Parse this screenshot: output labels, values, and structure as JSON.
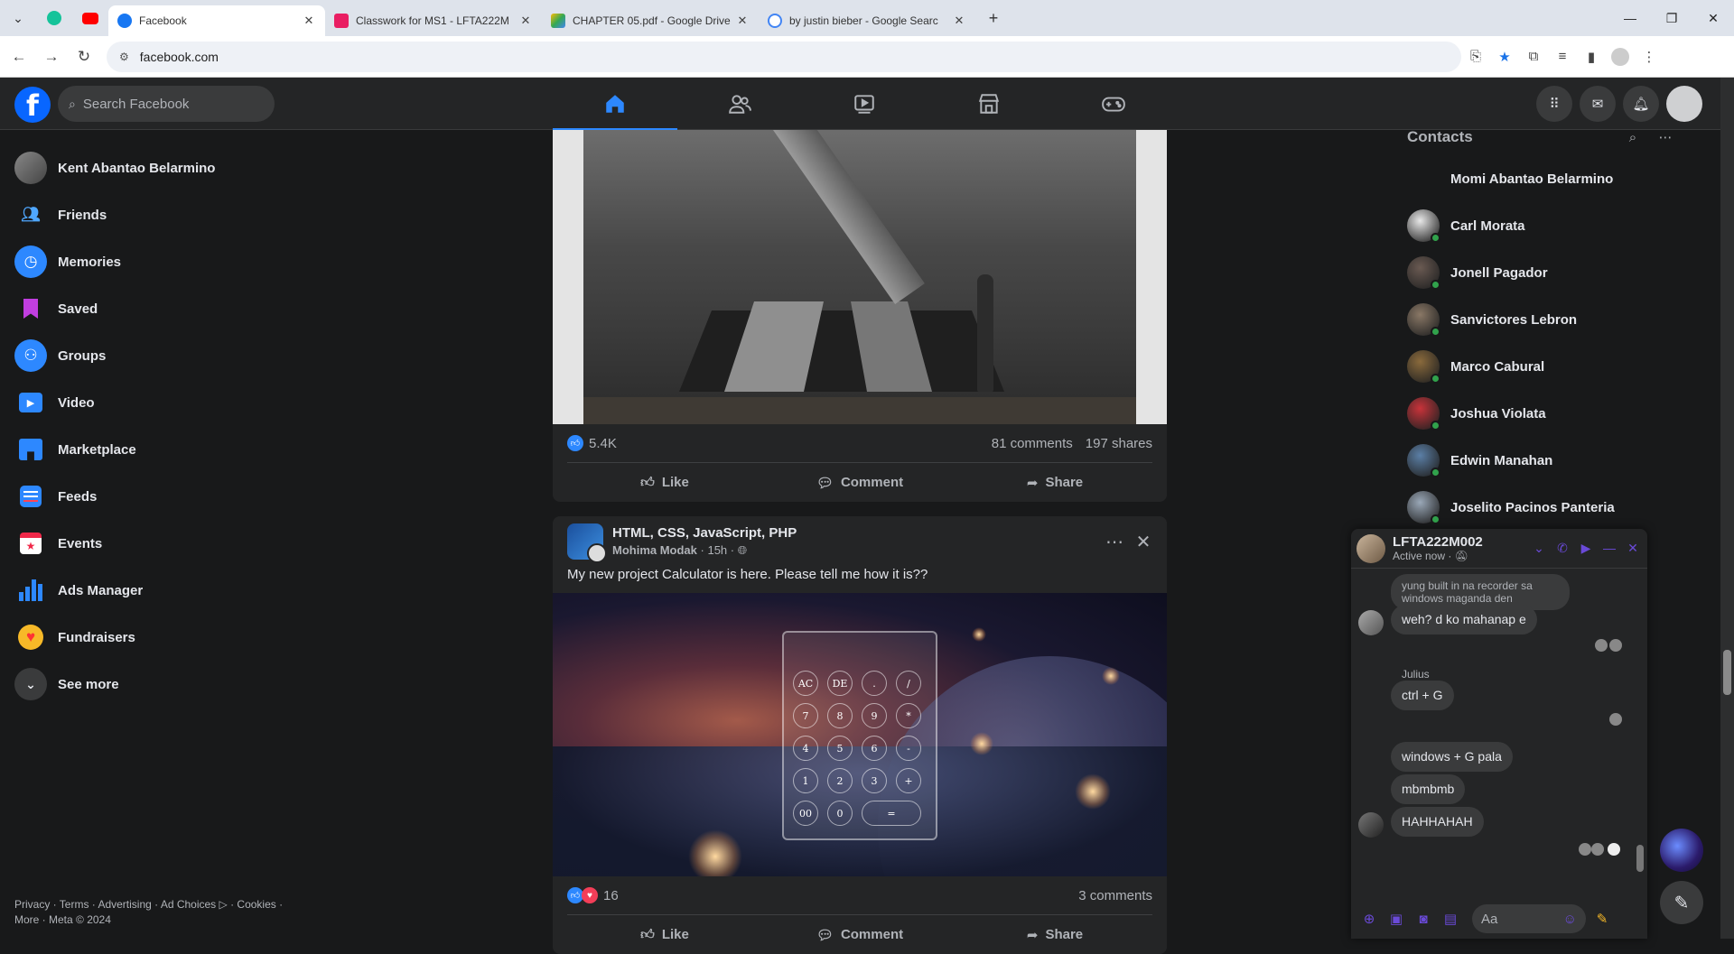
{
  "browser": {
    "tabs": [
      {
        "title": "Facebook",
        "active": true,
        "favicon": "facebook-icon",
        "color": "#1877f2"
      },
      {
        "title": "Classwork for MS1 - LFTA222M",
        "active": false,
        "favicon": "classroom-icon",
        "color": "#e91e63"
      },
      {
        "title": "CHAPTER 05.pdf - Google Drive",
        "active": false,
        "favicon": "drive-icon",
        "color": "#34a853"
      },
      {
        "title": "by justin bieber - Google Searc",
        "active": false,
        "favicon": "google-icon",
        "color": "#4285f4"
      }
    ],
    "url": "facebook.com"
  },
  "header": {
    "search_placeholder": "Search Facebook",
    "nav": [
      "home-icon",
      "friends-icon",
      "video-icon",
      "marketplace-icon",
      "gaming-icon"
    ],
    "active_nav": "home"
  },
  "sidebar": {
    "items": [
      {
        "label": "Kent Abantao Belarmino",
        "icon": "profile-avatar"
      },
      {
        "label": "Friends",
        "icon": "friends-icon"
      },
      {
        "label": "Memories",
        "icon": "memories-icon"
      },
      {
        "label": "Saved",
        "icon": "saved-icon"
      },
      {
        "label": "Groups",
        "icon": "groups-icon"
      },
      {
        "label": "Video",
        "icon": "video-icon"
      },
      {
        "label": "Marketplace",
        "icon": "marketplace-icon"
      },
      {
        "label": "Feeds",
        "icon": "feeds-icon"
      },
      {
        "label": "Events",
        "icon": "events-icon"
      },
      {
        "label": "Ads Manager",
        "icon": "ads-manager-icon"
      },
      {
        "label": "Fundraisers",
        "icon": "fundraisers-icon"
      },
      {
        "label": "See more",
        "icon": "chevron-down-icon"
      }
    ],
    "footer_line1": "Privacy · Terms · Advertising · Ad Choices ▷ · Cookies ·",
    "footer_line2": "More · Meta © 2024"
  },
  "posts": [
    {
      "reactions": "5.4K",
      "comments": "81 comments",
      "shares": "197 shares",
      "actions": [
        "Like",
        "Comment",
        "Share"
      ]
    },
    {
      "group": "HTML, CSS, JavaScript, PHP",
      "author": "Mohima Modak",
      "time": "15h",
      "text": "My new project Calculator is here. Please tell me how it is??",
      "reactions": "16",
      "comments": "3 comments",
      "actions": [
        "Like",
        "Comment",
        "Share"
      ],
      "calculator_keys": [
        "AC",
        "DE",
        ".",
        "/",
        "7",
        "8",
        "9",
        "*",
        "4",
        "5",
        "6",
        "-",
        "1",
        "2",
        "3",
        "+",
        "00",
        "0",
        "="
      ]
    }
  ],
  "contacts": {
    "title": "Contacts",
    "items": [
      {
        "name": "Momi Abantao Belarmino",
        "online": false
      },
      {
        "name": "Carl Morata",
        "online": true
      },
      {
        "name": "Jonell Pagador",
        "online": true
      },
      {
        "name": "Sanvictores Lebron",
        "online": true
      },
      {
        "name": "Marco Cabural",
        "online": true
      },
      {
        "name": "Joshua Violata",
        "online": true
      },
      {
        "name": "Edwin Manahan",
        "online": true
      },
      {
        "name": "Joselito Pacinos Panteria",
        "online": true
      }
    ]
  },
  "chat": {
    "name": "LFTA222M002",
    "status": "Active now ·",
    "messages": [
      {
        "text": "yung built in na recorder sa windows maganda den"
      },
      {
        "text": "weh? d ko mahanap e"
      },
      {
        "sender": "Julius"
      },
      {
        "text": "ctrl + G"
      },
      {
        "text": "windows + G pala"
      },
      {
        "text": "mbmbmb"
      },
      {
        "text": "HAHHAHAH"
      }
    ],
    "input_placeholder": "Aa"
  }
}
